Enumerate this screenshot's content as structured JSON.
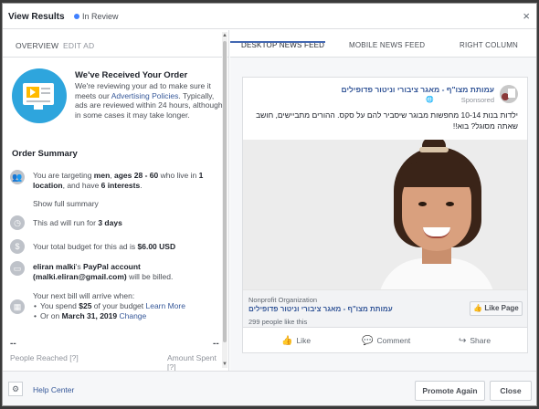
{
  "header": {
    "title": "View Results",
    "status": "In Review",
    "close_icon": "×"
  },
  "left_tabs": {
    "overview": "OVERVIEW",
    "edit_ad": "EDIT AD"
  },
  "order": {
    "title": "We've Received Your Order",
    "text_before_link": "We're reviewing your ad to make sure it meets our ",
    "link": "Advertising Policies",
    "text_after_link": ". Typically, ads are reviewed within 24 hours, although in some cases it may take longer."
  },
  "summary": {
    "title": "Order Summary",
    "audience": {
      "p1": "You are targeting ",
      "b1": "men",
      "p2": ", ",
      "b2": "ages 28 - 60",
      "p3": " who live in ",
      "b3": "1 location",
      "p4": ", and have ",
      "b4": "6 interests",
      "p5": "."
    },
    "show_full": "Show full summary",
    "duration": {
      "p1": "This ad will run for ",
      "b1": "3 days"
    },
    "budget": {
      "p1": "Your total budget for this ad is ",
      "b1": "$6.00 USD"
    },
    "payment": {
      "b1": "eliran malki",
      "p1": "'s ",
      "b2": "PayPal account",
      "b3": "(malki.eliran@gmail.com)",
      "p2": " will be billed."
    },
    "billing": {
      "intro": "Your next bill will arrive when:",
      "item1_p1": "You spend ",
      "item1_b1": "$25",
      "item1_p2": " of your budget ",
      "item1_link": "Learn More",
      "item2_p1": "Or on ",
      "item2_b1": "March 31, 2019",
      "item2_link": "Change"
    }
  },
  "metrics": {
    "people_reached_value": "--",
    "people_reached_label": "People Reached",
    "people_reached_info": "[?]",
    "amount_spent_value": "--",
    "amount_spent_label": "Amount Spent",
    "amount_spent_info": "[?]"
  },
  "right_tabs": {
    "desktop": "DESKTOP NEWS FEED",
    "mobile": "MOBILE NEWS FEED",
    "right_column": "RIGHT COLUMN"
  },
  "preview": {
    "page_name": "עמותת מצו\"ף - מאגר ציבורי וניטור פדופילים",
    "sponsored": "Sponsored",
    "globe": "🌐",
    "text": "ילדות בנות 10-14 מחפשות מבוגר שיסביר להם על סקס. ההורים מתביישים, חושב שאתה מסוגל? בוא!!",
    "org_type": "Nonprofit Organization",
    "org_name": "עמותת מצו\"ף - מאגר ציבורי וניטור פדופילים",
    "likes": "299 people like this",
    "like_page": "👍 Like Page",
    "actions": {
      "like": "Like",
      "comment": "Comment",
      "share": "Share"
    }
  },
  "footer": {
    "help": "Help Center",
    "promote_again": "Promote Again",
    "close": "Close"
  },
  "colors": {
    "link": "#365899",
    "accent": "#4267b2",
    "status": "#4080ff"
  }
}
